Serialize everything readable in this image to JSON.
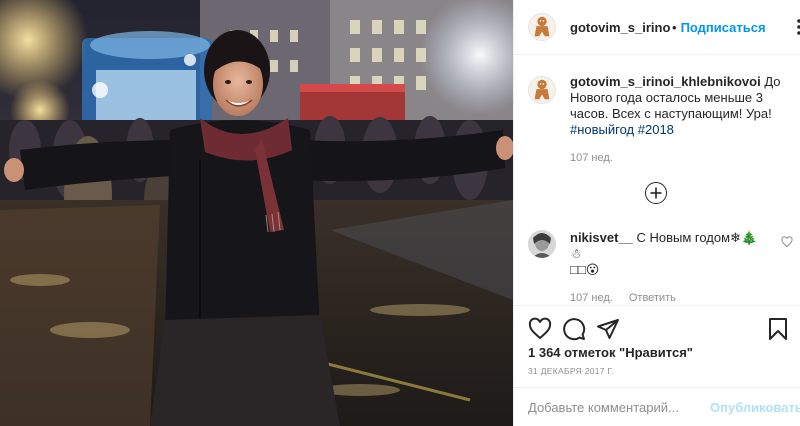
{
  "photo": {
    "alt": ""
  },
  "header": {
    "username": "gotovim_s_irinoi_kh",
    "separator": "•",
    "follow_label": "Подписаться"
  },
  "caption": {
    "username": "gotovim_s_irinoi_khlebnikovoi",
    "text": " До Нового года осталось меньше 3 часов. Всех с наступающим! Ура! ",
    "hashtags": [
      "#новыйгод",
      "#2018"
    ],
    "time": "107 нед."
  },
  "comments": [
    {
      "username": "nikisvet__",
      "text": " С Новым годом❄🎄☃\n□□😮",
      "time": "107 нед.",
      "reply_label": "Ответить"
    }
  ],
  "likes_text": "1 364 отметок \"Нравится\"",
  "date_text": "31 ДЕКАБРЯ 2017 Г.",
  "add_comment": {
    "placeholder": "Добавьте комментарий...",
    "publish_label": "Опубликовать"
  },
  "colors": {
    "accent": "#0095f6",
    "publish_disabled": "#b2dffc",
    "hashtag": "#00376b",
    "muted": "#8e8e8e"
  },
  "icons": {
    "more": "more-dots-icon",
    "load_more": "plus-circle-icon",
    "like": "heart-icon",
    "comment": "comment-icon",
    "share": "paper-plane-icon",
    "save": "bookmark-icon"
  }
}
